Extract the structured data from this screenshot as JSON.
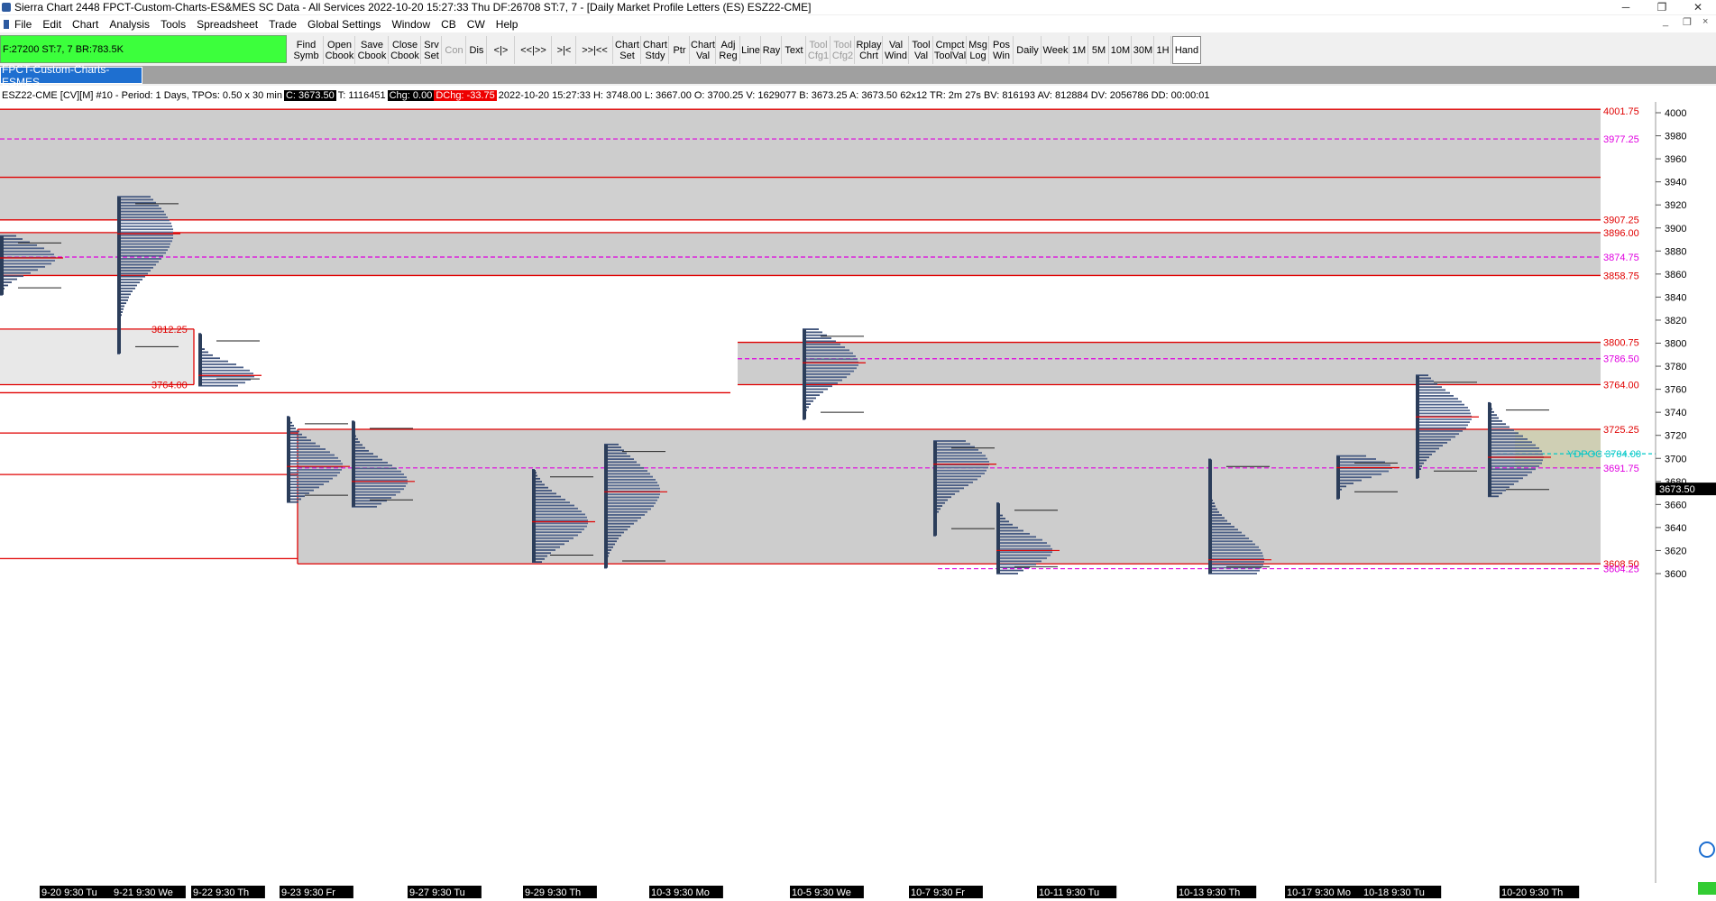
{
  "window": {
    "title": "Sierra Chart 2448 FPCT-Custom-Charts-ES&MES  SC Data - All Services 2022-10-20  15:27:33 Thu  DF:26708  ST:7, 7 - [Daily Market Profile Letters (ES) ESZ22-CME]",
    "minimize": "─",
    "restore": "❐",
    "close": "✕"
  },
  "menu": [
    "File",
    "Edit",
    "Chart",
    "Analysis",
    "Tools",
    "Spreadsheet",
    "Trade",
    "Global Settings",
    "Window",
    "CB",
    "CW",
    "Help"
  ],
  "status_box": "F:27200  ST:7, 7  BR:783.5K",
  "toolbar": [
    {
      "l1": "Find",
      "l2": "Symb"
    },
    {
      "l1": "Open",
      "l2": "Cbook"
    },
    {
      "l1": "Save",
      "l2": "Cbook"
    },
    {
      "l1": "Close",
      "l2": "Cbook"
    },
    {
      "l1": "Srv",
      "l2": "Set"
    },
    {
      "l1": "Con",
      "l2": ""
    },
    {
      "l1": "Dis",
      "l2": ""
    },
    {
      "l1": "<|>",
      "l2": ""
    },
    {
      "l1": "<<|>>",
      "l2": ""
    },
    {
      "l1": ">|<",
      "l2": ""
    },
    {
      "l1": ">>|<<",
      "l2": ""
    },
    {
      "l1": "Chart",
      "l2": "Set"
    },
    {
      "l1": "Chart",
      "l2": "Stdy"
    },
    {
      "l1": "Ptr",
      "l2": ""
    },
    {
      "l1": "Chart",
      "l2": "Val"
    },
    {
      "l1": "Adj",
      "l2": "Reg"
    },
    {
      "l1": "Line",
      "l2": ""
    },
    {
      "l1": "Ray",
      "l2": ""
    },
    {
      "l1": "Text",
      "l2": ""
    },
    {
      "l1": "Tool",
      "l2": "Cfg1"
    },
    {
      "l1": "Tool",
      "l2": "Cfg2"
    },
    {
      "l1": "Rplay",
      "l2": "Chrt"
    },
    {
      "l1": "Val",
      "l2": "Wind"
    },
    {
      "l1": "Tool",
      "l2": "Val"
    },
    {
      "l1": "Cmpct",
      "l2": "ToolVal"
    },
    {
      "l1": "Msg",
      "l2": "Log"
    },
    {
      "l1": "Pos",
      "l2": "Win"
    },
    {
      "l1": "Daily",
      "l2": ""
    },
    {
      "l1": "Week",
      "l2": ""
    },
    {
      "l1": "1M",
      "l2": ""
    },
    {
      "l1": "5M",
      "l2": ""
    },
    {
      "l1": "10M",
      "l2": ""
    },
    {
      "l1": "30M",
      "l2": ""
    },
    {
      "l1": "1H",
      "l2": ""
    },
    {
      "l1": "Hand",
      "l2": ""
    }
  ],
  "tab": "FPCT-Custom-Charts-ESMES",
  "info": {
    "symbol": "ESZ22-CME [CV][M]  #10 - Period: 1 Days, TPOs: 0.50 x 30 min",
    "c": "C: 3673.50",
    "t": "T: 1116451",
    "chg": "Chg: 0.00",
    "dchg": "DChg: -33.75",
    "rest": "2022-10-20 15:27:33 H: 3748.00 L: 3667.00 O: 3700.25 V: 1629077 B: 3673.25 A: 3673.50 62x12 TR: 2m 27s BV: 816193 AV: 812884 DV: 2056786 DD: 00:00:01"
  },
  "chart_data": {
    "type": "market-profile",
    "y_axis": {
      "min": 3600,
      "max": 4000,
      "ticks": [
        4000,
        3980,
        3960,
        3940,
        3920,
        3900,
        3880,
        3860,
        3840,
        3820,
        3800,
        3780,
        3760,
        3740,
        3720,
        3700,
        3680,
        3660,
        3640,
        3620,
        3600
      ]
    },
    "last_price": "3673.50",
    "level_labels": [
      {
        "text": "4001.75",
        "price": 4001.75,
        "color": "#e00000"
      },
      {
        "text": "3977.25",
        "price": 3977.25,
        "color": "#e000e0"
      },
      {
        "text": "3907.25",
        "price": 3907.25,
        "color": "#e00000"
      },
      {
        "text": "3896.00",
        "price": 3896.0,
        "color": "#e00000"
      },
      {
        "text": "3874.75",
        "price": 3874.75,
        "color": "#e000e0"
      },
      {
        "text": "3858.75",
        "price": 3858.75,
        "color": "#e00000"
      },
      {
        "text": "3812.25",
        "price": 3812.25,
        "color": "#e00000"
      },
      {
        "text": "3764.00",
        "price": 3764.0,
        "color": "#e00000"
      },
      {
        "text": "3800.75",
        "price": 3800.75,
        "color": "#e00000"
      },
      {
        "text": "3786.50",
        "price": 3786.5,
        "color": "#e000e0"
      },
      {
        "text": "3764.00",
        "price": 3764.0,
        "color": "#e00000"
      },
      {
        "text": "3725.25",
        "price": 3725.25,
        "color": "#e00000"
      },
      {
        "text": "YDPOC  3704.00",
        "price": 3704.0,
        "color": "#00c8c8"
      },
      {
        "text": "3691.75",
        "price": 3691.75,
        "color": "#e000e0"
      },
      {
        "text": "3608.50",
        "price": 3608.5,
        "color": "#e00000"
      },
      {
        "text": "3604.25",
        "price": 3604.25,
        "color": "#e000e0"
      }
    ],
    "sessions": [
      {
        "label": "9-20  9:30 Tu",
        "hi": 3893,
        "lo": 3842,
        "poc": 3874
      },
      {
        "label": "9-21  9:30 We",
        "hi": 3927,
        "lo": 3791,
        "poc": 3895
      },
      {
        "label": "9-22  9:30 Th",
        "hi": 3808,
        "lo": 3763,
        "poc": 3772
      },
      {
        "label": "9-23  9:30 Fr",
        "hi": 3736,
        "lo": 3662,
        "poc": 3693
      },
      {
        "label": "9-27  9:30 Tu",
        "hi": 3732,
        "lo": 3658,
        "poc": 3680
      },
      {
        "label": "9-29  9:30 Th",
        "hi": 3690,
        "lo": 3610,
        "poc": 3645
      },
      {
        "label": "10-3  9:30 Mo",
        "hi": 3712,
        "lo": 3605,
        "poc": 3671
      },
      {
        "label": "10-5  9:30 We",
        "hi": 3812,
        "lo": 3734,
        "poc": 3783
      },
      {
        "label": "10-7  9:30 Fr",
        "hi": 3715,
        "lo": 3633,
        "poc": 3695
      },
      {
        "label": "10-11  9:30 Tu",
        "hi": 3661,
        "lo": 3600,
        "poc": 3620
      },
      {
        "label": "10-13  9:30 Th",
        "hi": 3699,
        "lo": 3600,
        "poc": 3612
      },
      {
        "label": "10-17  9:30 Mo",
        "hi": 3702,
        "lo": 3665,
        "poc": 3692
      },
      {
        "label": "10-18  9:30 Tu",
        "hi": 3772,
        "lo": 3683,
        "poc": 3736
      },
      {
        "label": "10-20  9:30 Th",
        "hi": 3748,
        "lo": 3667,
        "poc": 3701
      }
    ]
  }
}
